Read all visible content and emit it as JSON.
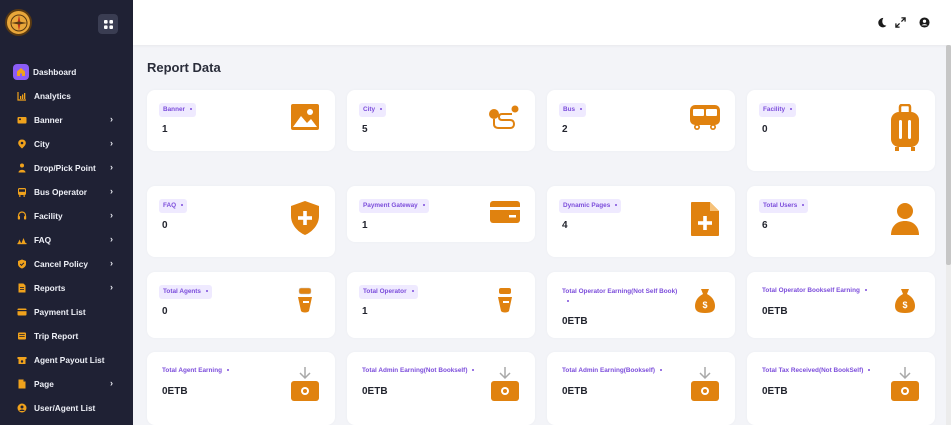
{
  "sidebar": {
    "items": [
      {
        "label": "Dashboard",
        "icon": "home-icon",
        "active": true,
        "chevron": false
      },
      {
        "label": "Analytics",
        "icon": "analytics-icon",
        "chevron": false
      },
      {
        "label": "Banner",
        "icon": "banner-icon",
        "chevron": true
      },
      {
        "label": "City",
        "icon": "location-icon",
        "chevron": true
      },
      {
        "label": "Drop/Pick Point",
        "icon": "person-pin-icon",
        "chevron": true
      },
      {
        "label": "Bus Operator",
        "icon": "bus-icon",
        "chevron": true
      },
      {
        "label": "Facility",
        "icon": "headset-icon",
        "chevron": true
      },
      {
        "label": "FAQ",
        "icon": "faq-icon",
        "chevron": true
      },
      {
        "label": "Cancel Policy",
        "icon": "shield-icon",
        "chevron": true
      },
      {
        "label": "Reports",
        "icon": "report-icon",
        "chevron": true
      },
      {
        "label": "Payment List",
        "icon": "payment-list-icon",
        "chevron": false
      },
      {
        "label": "Trip Report",
        "icon": "trip-report-icon",
        "chevron": false
      },
      {
        "label": "Agent Payout List",
        "icon": "payout-icon",
        "chevron": false
      },
      {
        "label": "Page",
        "icon": "page-icon",
        "chevron": true
      },
      {
        "label": "User/Agent List",
        "icon": "user-icon",
        "chevron": false
      }
    ],
    "chevron_glyph": "›"
  },
  "main": {
    "title": "Report Data",
    "cards": [
      {
        "label": "Banner",
        "value": "1",
        "icon": "image-icon"
      },
      {
        "label": "City",
        "value": "5",
        "icon": "route-icon"
      },
      {
        "label": "Bus",
        "value": "2",
        "icon": "bus-icon"
      },
      {
        "label": "Facility",
        "value": "0",
        "icon": "luggage-icon"
      },
      {
        "label": "FAQ",
        "value": "0",
        "icon": "shield-plus-icon"
      },
      {
        "label": "Payment Gateway",
        "value": "1",
        "icon": "credit-card-icon"
      },
      {
        "label": "Dynamic Pages",
        "value": "4",
        "icon": "file-plus-icon"
      },
      {
        "label": "Total Users",
        "value": "6",
        "icon": "user-icon"
      },
      {
        "label": "Total Agents",
        "value": "0",
        "icon": "agent-icon"
      },
      {
        "label": "Total Operator",
        "value": "1",
        "icon": "agent-icon"
      },
      {
        "label": "Total Operator Earning(Not Self Book)",
        "value": "0ETB",
        "icon": "money-bag-icon"
      },
      {
        "label": "Total Operator Bookself Earning",
        "value": "0ETB",
        "icon": "money-bag-icon"
      },
      {
        "label": "Total Agent Earning",
        "value": "0ETB",
        "icon": "withdraw-icon"
      },
      {
        "label": "Total Admin Earning(Not Bookself)",
        "value": "0ETB",
        "icon": "withdraw-icon"
      },
      {
        "label": "Total Admin Earning(Bookself)",
        "value": "0ETB",
        "icon": "withdraw-icon"
      },
      {
        "label": "Total Tax Received(Not BookSelf)",
        "value": "0ETB",
        "icon": "withdraw-icon"
      }
    ]
  },
  "colors": {
    "sidebar_bg": "#1f2134",
    "accent_purple": "#8b5cf6",
    "icon_orange": "#e0820f",
    "sidebar_icon": "#f0a21c"
  }
}
